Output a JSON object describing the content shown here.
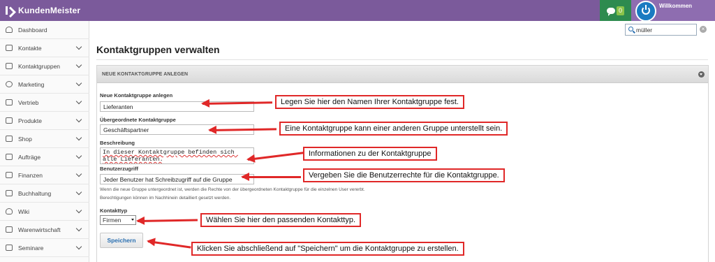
{
  "app": {
    "brand": "KundenMeister",
    "chat_count": "0",
    "welcome": "Willkommen"
  },
  "search": {
    "value": "müller"
  },
  "sidebar": {
    "items": [
      {
        "label": "Dashboard",
        "icon": "dashboard-icon",
        "has_children": false
      },
      {
        "label": "Kontakte",
        "icon": "contacts-icon",
        "has_children": true
      },
      {
        "label": "Kontaktgruppen",
        "icon": "contact-groups-icon",
        "has_children": true
      },
      {
        "label": "Marketing",
        "icon": "marketing-icon",
        "has_children": true
      },
      {
        "label": "Vertrieb",
        "icon": "sales-icon",
        "has_children": true
      },
      {
        "label": "Produkte",
        "icon": "products-icon",
        "has_children": true
      },
      {
        "label": "Shop",
        "icon": "shop-icon",
        "has_children": true
      },
      {
        "label": "Aufträge",
        "icon": "orders-icon",
        "has_children": true
      },
      {
        "label": "Finanzen",
        "icon": "finance-icon",
        "has_children": true
      },
      {
        "label": "Buchhaltung",
        "icon": "accounting-icon",
        "has_children": true
      },
      {
        "label": "Wiki",
        "icon": "wiki-icon",
        "has_children": true
      },
      {
        "label": "Warenwirtschaft",
        "icon": "inventory-icon",
        "has_children": true
      },
      {
        "label": "Seminare",
        "icon": "seminars-icon",
        "has_children": true
      }
    ]
  },
  "main": {
    "title": "Kontaktgruppen verwalten",
    "panel_title": "NEUE KONTAKTGRUPPE ANLEGEN",
    "form": {
      "name_label": "Neue Kontaktgruppe anlegen",
      "name_value": "Lieferanten",
      "parent_label": "Übergeordnete Kontaktgruppe",
      "parent_value": "Geschäftspartner",
      "description_label": "Beschreibung",
      "description_value": "In dieser Kontaktgruppe befinden sich alle Lieferanten.",
      "access_label": "Benutzerzugriff",
      "access_value": "Jeder Benutzer hat Schreibzugriff auf die Gruppe",
      "help_line1": "Wenn die neue Gruppe untergeordnet ist, werden die Rechte von der übergeordneten Kontaktgruppe für die einzelnen User vererbt.",
      "help_line2": "Berechtigungen können im Nachhinein detailliert gesetzt werden.",
      "type_label": "Kontakttyp",
      "type_value": "Firmen",
      "save_label": "Speichern"
    }
  },
  "callouts": {
    "name": "Legen Sie hier den Namen Ihrer Kontaktgruppe fest.",
    "parent": "Eine Kontaktgruppe kann einer anderen Gruppe unterstellt sein.",
    "description": "Informationen zu der Kontaktgruppe",
    "access": "Vergeben Sie die Benutzerrechte für die Kontaktgruppe.",
    "type": "Wählen Sie hier den passenden Kontakttyp.",
    "save": "Klicken Sie abschließend auf \"Speichern\" um die Kontaktgruppe zu erstellen."
  },
  "colors": {
    "topbar": "#7b5a9b",
    "chat": "#2e8b4f",
    "accent_red": "#e02828",
    "link_blue": "#2a6fb0"
  }
}
